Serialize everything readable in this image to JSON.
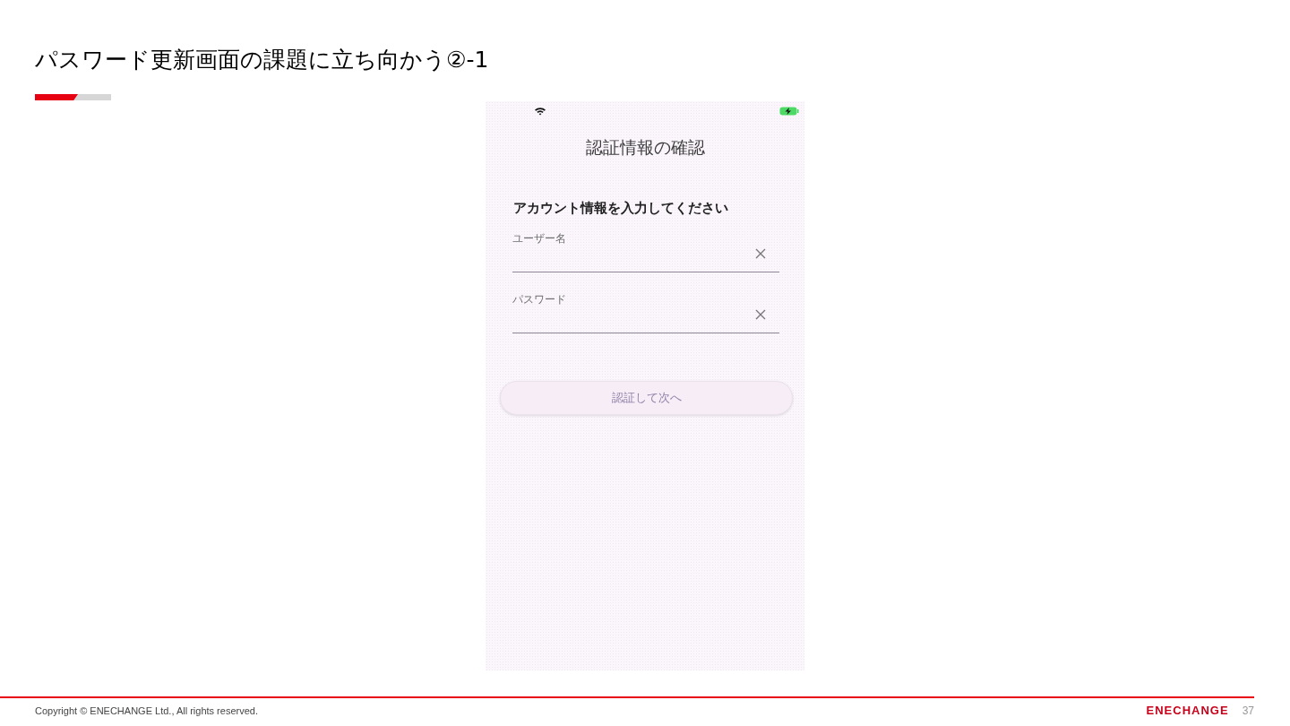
{
  "slide": {
    "title": "パスワード更新画面の課題に立ち向かう②-1"
  },
  "phone_screen": {
    "title": "認証情報の確認",
    "prompt": "アカウント情報を入力してください",
    "fields": [
      {
        "label": "ユーザー名"
      },
      {
        "label": "パスワード"
      }
    ],
    "button": {
      "label": "認証して次へ",
      "disabled": true
    }
  },
  "footer": {
    "copyright": "Copyright © ENECHANGE Ltd.,  All rights reserved.",
    "logo": "ENECHANGE",
    "page_number": "37"
  }
}
